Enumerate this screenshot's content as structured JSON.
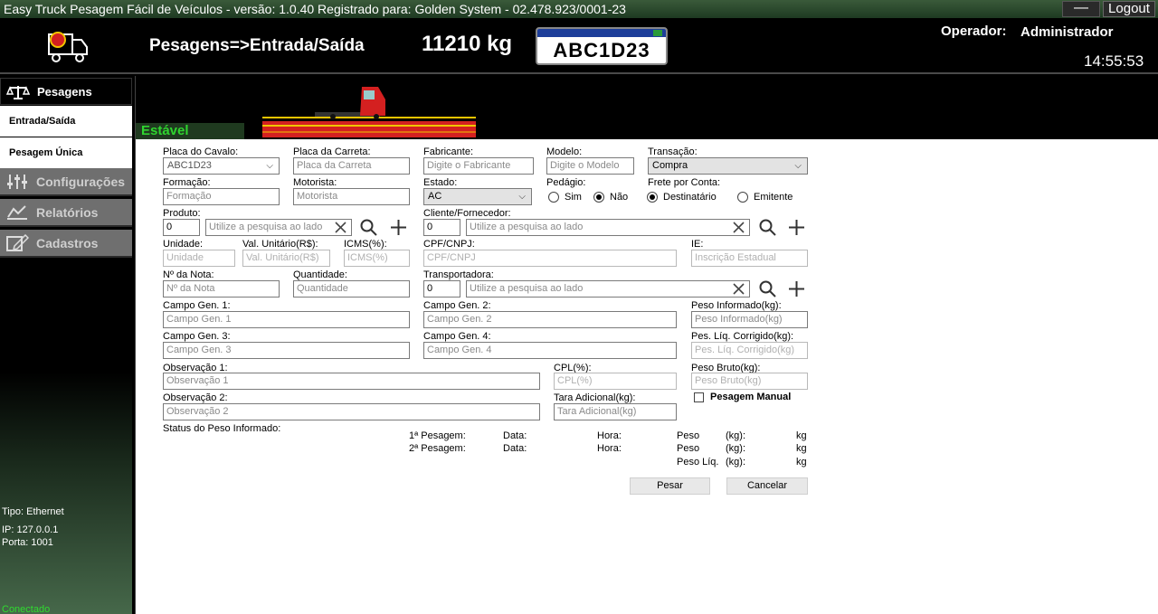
{
  "window": {
    "title": "Easy Truck Pesagem Fácil de Veículos - versão: 1.0.40 Registrado para: Golden System - 02.478.923/0001-23",
    "minimize_label": "—",
    "logout_label": "Logout"
  },
  "header": {
    "page_title": "Pesagens=>Entrada/Saída",
    "weight": "11210 kg",
    "plate": "ABC1D23",
    "operator_label": "Operador:",
    "operator_name": "Administrador",
    "clock": "14:55:53"
  },
  "sidebar": {
    "pesagens": "Pesagens",
    "entrada_saida": "Entrada/Saída",
    "pesagem_unica": "Pesagem Única",
    "configuracoes": "Configurações",
    "relatorios": "Relatórios",
    "cadastros": "Cadastros",
    "net_tipo": "Tipo: Ethernet",
    "net_ip": "IP: 127.0.0.1",
    "net_porta": "Porta: 1001",
    "net_status": "Conectado"
  },
  "scale": {
    "status": "Estável"
  },
  "form": {
    "placa_cavalo": {
      "label": "Placa do Cavalo:",
      "value": "ABC1D23"
    },
    "placa_carreta": {
      "label": "Placa da Carreta:",
      "placeholder": "Placa da Carreta"
    },
    "fabricante": {
      "label": "Fabricante:",
      "placeholder": "Digite o Fabricante"
    },
    "modelo": {
      "label": "Modelo:",
      "placeholder": "Digite o Modelo"
    },
    "transacao": {
      "label": "Transação:",
      "value": "Compra"
    },
    "formacao": {
      "label": "Formação:",
      "placeholder": "Formação"
    },
    "motorista": {
      "label": "Motorista:",
      "placeholder": "Motorista"
    },
    "estado": {
      "label": "Estado:",
      "value": "AC"
    },
    "pedagio": {
      "label": "Pedágio:",
      "sim": "Sim",
      "nao": "Não"
    },
    "frete": {
      "label": "Frete por Conta:",
      "destinatario": "Destinatário",
      "emitente": "Emitente"
    },
    "produto": {
      "label": "Produto:",
      "code": "0",
      "placeholder": "Utilize a pesquisa ao lado"
    },
    "cliente": {
      "label": "Cliente/Fornecedor:",
      "code": "0",
      "placeholder": "Utilize a pesquisa ao lado"
    },
    "unidade": {
      "label": "Unidade:",
      "placeholder": "Unidade"
    },
    "val_unitario": {
      "label": "Val. Unitário(R$):",
      "placeholder": "Val. Unitário(R$)"
    },
    "icms": {
      "label": "ICMS(%):",
      "placeholder": "ICMS(%)"
    },
    "cpf_cnpj": {
      "label": "CPF/CNPJ:",
      "placeholder": "CPF/CNPJ"
    },
    "ie": {
      "label": "IE:",
      "placeholder": "Inscrição Estadual"
    },
    "nota": {
      "label": "Nº da Nota:",
      "placeholder": "Nº da Nota"
    },
    "quantidade": {
      "label": "Quantidade:",
      "placeholder": "Quantidade"
    },
    "transportadora": {
      "label": "Transportadora:",
      "code": "0",
      "placeholder": "Utilize a pesquisa ao lado"
    },
    "campo1": {
      "label": "Campo Gen. 1:",
      "placeholder": "Campo Gen. 1"
    },
    "campo2": {
      "label": "Campo Gen. 2:",
      "placeholder": "Campo Gen. 2"
    },
    "peso_informado": {
      "label": "Peso Informado(kg):",
      "placeholder": "Peso Informado(kg)"
    },
    "campo3": {
      "label": "Campo Gen. 3:",
      "placeholder": "Campo Gen. 3"
    },
    "campo4": {
      "label": "Campo Gen. 4:",
      "placeholder": "Campo Gen. 4"
    },
    "pes_liq": {
      "label": "Pes. Líq. Corrigido(kg):",
      "placeholder": "Pes. Líq. Corrigido(kg)"
    },
    "obs1": {
      "label": "Observação 1:",
      "placeholder": "Observação 1"
    },
    "cpl": {
      "label": "CPL(%):",
      "placeholder": "CPL(%)"
    },
    "peso_bruto": {
      "label": "Peso Bruto(kg):",
      "placeholder": "Peso Bruto(kg)"
    },
    "obs2": {
      "label": "Observação 2:",
      "placeholder": "Observação 2"
    },
    "tara": {
      "label": "Tara Adicional(kg):",
      "placeholder": "Tara Adicional(kg)"
    },
    "pesagem_manual": "Pesagem Manual",
    "status_peso": "Status do Peso Informado:"
  },
  "summary": {
    "p1": "1ª Pesagem:",
    "p2": "2ª Pesagem:",
    "data": "Data:",
    "hora": "Hora:",
    "peso": "Peso",
    "peso_liq": "Peso Líq.",
    "kg_paren": "(kg):",
    "kg": "kg"
  },
  "buttons": {
    "pesar": "Pesar",
    "cancelar": "Cancelar"
  },
  "colors": {
    "accent_green": "#2fd52f",
    "sidebar_grey": "#6f6f6f",
    "plate_blue": "#1d3e9a",
    "truck_red": "#d42020",
    "scale_yellow": "#f2c400"
  }
}
